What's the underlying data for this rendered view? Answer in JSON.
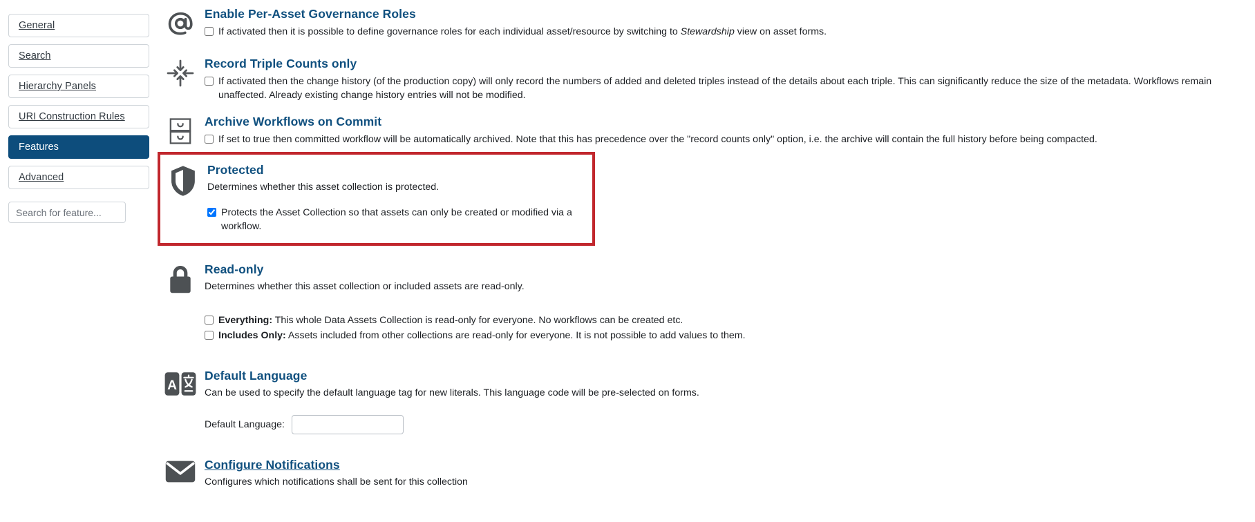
{
  "sidebar": {
    "items": [
      {
        "label": "General",
        "active": false
      },
      {
        "label": "Search",
        "active": false
      },
      {
        "label": "Hierarchy Panels",
        "active": false
      },
      {
        "label": "URI Construction Rules",
        "active": false
      },
      {
        "label": "Features",
        "active": true
      },
      {
        "label": "Advanced",
        "active": false
      }
    ],
    "search": {
      "placeholder": "Search for feature...",
      "value": ""
    }
  },
  "colors": {
    "accent_blue": "#10507f",
    "active_nav": "#0d4d7c",
    "highlight_red": "#c1272d",
    "checkbox_checked": "#1a73e8",
    "icon_gray": "#4d5154"
  },
  "features": [
    {
      "icon": "at-sign-icon",
      "title": "Enable Per-Asset Governance Roles",
      "checkbox_label_pre": "If activated then it is possible to define governance roles for each individual asset/resource by switching to ",
      "checkbox_label_em": "Stewardship",
      "checkbox_label_post": " view on asset forms.",
      "checked": false
    },
    {
      "icon": "compress-arrows-icon",
      "title": "Record Triple Counts only",
      "checkbox_label": "If activated then the change history (of the production copy) will only record the numbers of added and deleted triples instead of the details about each triple. This can significantly reduce the size of the metadata. Workflows remain unaffected. Already existing change history entries will not be modified.",
      "checked": false
    },
    {
      "icon": "archive-drawers-icon",
      "title": "Archive Workflows on Commit",
      "checkbox_label": "If set to true then committed workflow will be automatically archived. Note that this has precedence over the \"record counts only\" option, i.e. the archive will contain the full history before being compacted.",
      "checked": false
    }
  ],
  "protected": {
    "icon": "shield-icon",
    "title": "Protected",
    "description": "Determines whether this asset collection is protected.",
    "checkbox_label": "Protects the Asset Collection so that assets can only be created or modified via a workflow.",
    "checked": true,
    "highlighted": true
  },
  "readonly": {
    "icon": "lock-icon",
    "title": "Read-only",
    "description": "Determines whether this asset collection or included assets are read-only.",
    "options": [
      {
        "bold_prefix": "Everything:",
        "text": " This whole Data Assets Collection is read-only for everyone. No workflows can be created etc.",
        "checked": false
      },
      {
        "bold_prefix": "Includes Only:",
        "text": " Assets included from other collections are read-only for everyone. It is not possible to add values to them.",
        "checked": false
      }
    ]
  },
  "default_language": {
    "icon": "translate-icon",
    "title": "Default Language",
    "description": "Can be used to specify the default language tag for new literals. This language code will be pre-selected on forms.",
    "field_label": "Default Language:",
    "field_value": "",
    "field_placeholder": ""
  },
  "notifications": {
    "icon": "envelope-icon",
    "title": "Configure Notifications",
    "description": "Configures which notifications shall be sent for this collection"
  }
}
